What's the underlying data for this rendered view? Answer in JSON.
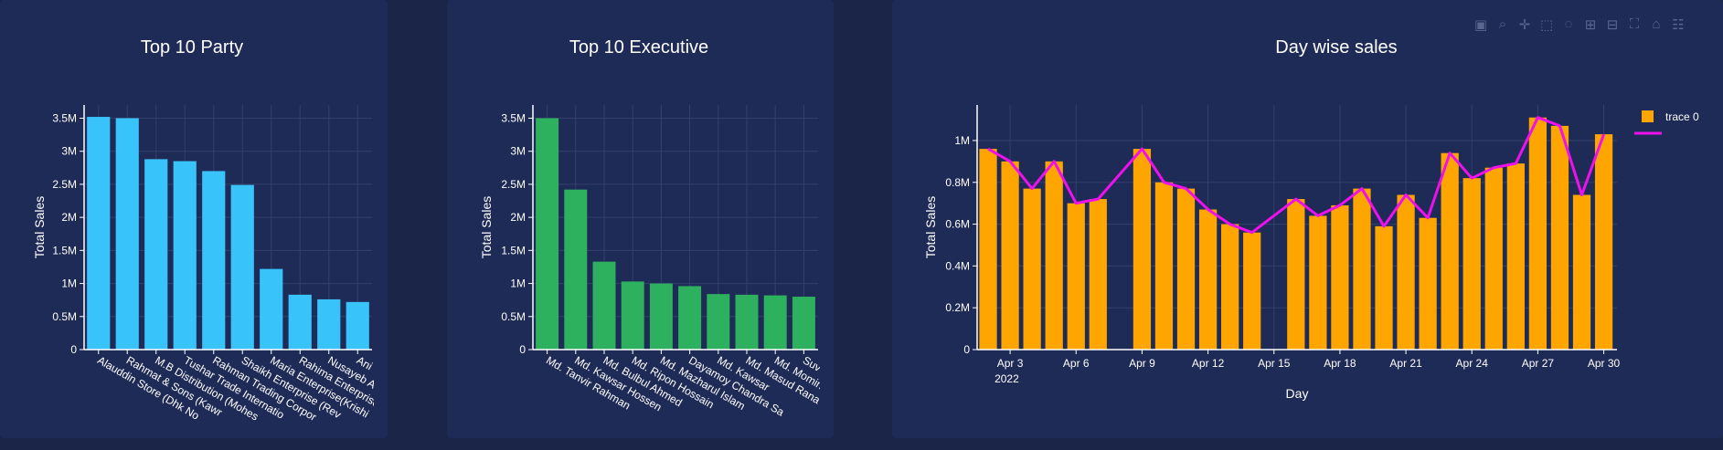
{
  "colors": {
    "background": "#1a2548",
    "panel": "#1f2b57",
    "grid": "#34406a",
    "party_bar": "#38c3fa",
    "executive_bar": "#2eb15e",
    "day_bar": "#ffa500",
    "day_line": "#ee11ee"
  },
  "modebar": {
    "icons": [
      "camera-icon",
      "zoom-icon",
      "pan-icon",
      "box-select-icon",
      "lasso-select-icon",
      "zoom-in-icon",
      "zoom-out-icon",
      "autoscale-icon",
      "reset-axes-icon",
      "plotly-logo-icon"
    ]
  },
  "chart_data": [
    {
      "type": "bar",
      "title": "Top 10 Party",
      "xlabel": "",
      "ylabel": "Total Sales",
      "ylim": [
        0,
        3.7
      ],
      "yticks": [
        "0",
        "0.5M",
        "1M",
        "1.5M",
        "2M",
        "2.5M",
        "3M",
        "3.5M"
      ],
      "categories": [
        "Alauddin Store (Dhk No",
        "Rahmat & Sons (Kawr",
        "M.B Distribution (Mohes",
        "Tushar Trade Internatio",
        "Rahman Trading Corpor",
        "Shaikh Enterprise (Rev",
        "Maria Enterprise(Krishi",
        "Rahima Enterprise",
        "Nusayeb A",
        "Ani"
      ],
      "values": [
        3.52,
        3.5,
        2.88,
        2.85,
        2.7,
        2.49,
        1.22,
        0.83,
        0.76,
        0.72
      ],
      "grid": true
    },
    {
      "type": "bar",
      "title": "Top 10 Executive",
      "xlabel": "",
      "ylabel": "Total Sales",
      "ylim": [
        0,
        3.7
      ],
      "yticks": [
        "0",
        "0.5M",
        "1M",
        "1.5M",
        "2M",
        "2.5M",
        "3M",
        "3.5M"
      ],
      "categories": [
        "Md. Tanvir Rahman",
        "Md. Kawsar Hossen",
        "Md. Bulbul Ahmed",
        "Md. Ripon Hossain",
        "Md. Mazharul Islam",
        "Dayamoy Chandra Sa",
        "Md. Kawsar",
        "Md. Masud Rana",
        "Md. Momin",
        "Suv"
      ],
      "values": [
        3.5,
        2.42,
        1.33,
        1.03,
        1.0,
        0.96,
        0.84,
        0.83,
        0.82,
        0.8
      ],
      "grid": true
    },
    {
      "type": "bar",
      "title": "Day wise sales",
      "xlabel": "Day",
      "ylabel": "Total Sales",
      "ylim": [
        0,
        1.17
      ],
      "yticks": [
        "0",
        "0.2M",
        "0.4M",
        "0.6M",
        "0.8M",
        "1M"
      ],
      "xticks": [
        {
          "day": 3,
          "label": "Apr 3",
          "sub": "2022"
        },
        {
          "day": 6,
          "label": "Apr 6",
          "sub": ""
        },
        {
          "day": 9,
          "label": "Apr 9",
          "sub": ""
        },
        {
          "day": 12,
          "label": "Apr 12",
          "sub": ""
        },
        {
          "day": 15,
          "label": "Apr 15",
          "sub": ""
        },
        {
          "day": 18,
          "label": "Apr 18",
          "sub": ""
        },
        {
          "day": 21,
          "label": "Apr 21",
          "sub": ""
        },
        {
          "day": 24,
          "label": "Apr 24",
          "sub": ""
        },
        {
          "day": 27,
          "label": "Apr 27",
          "sub": ""
        },
        {
          "day": 30,
          "label": "Apr 30",
          "sub": ""
        }
      ],
      "x_range": [
        1.5,
        30.6
      ],
      "days": [
        2,
        3,
        4,
        5,
        6,
        7,
        9,
        10,
        11,
        12,
        13,
        14,
        16,
        17,
        18,
        19,
        20,
        21,
        22,
        23,
        24,
        25,
        26,
        27,
        28,
        29,
        30
      ],
      "values": [
        0.96,
        0.9,
        0.77,
        0.9,
        0.7,
        0.72,
        0.96,
        0.8,
        0.77,
        0.67,
        0.6,
        0.56,
        0.72,
        0.64,
        0.69,
        0.77,
        0.59,
        0.74,
        0.63,
        0.94,
        0.82,
        0.87,
        0.89,
        1.11,
        1.07,
        0.74,
        1.03
      ],
      "legend": {
        "name": "trace 0",
        "placement": "top-right"
      },
      "grid": true
    }
  ]
}
